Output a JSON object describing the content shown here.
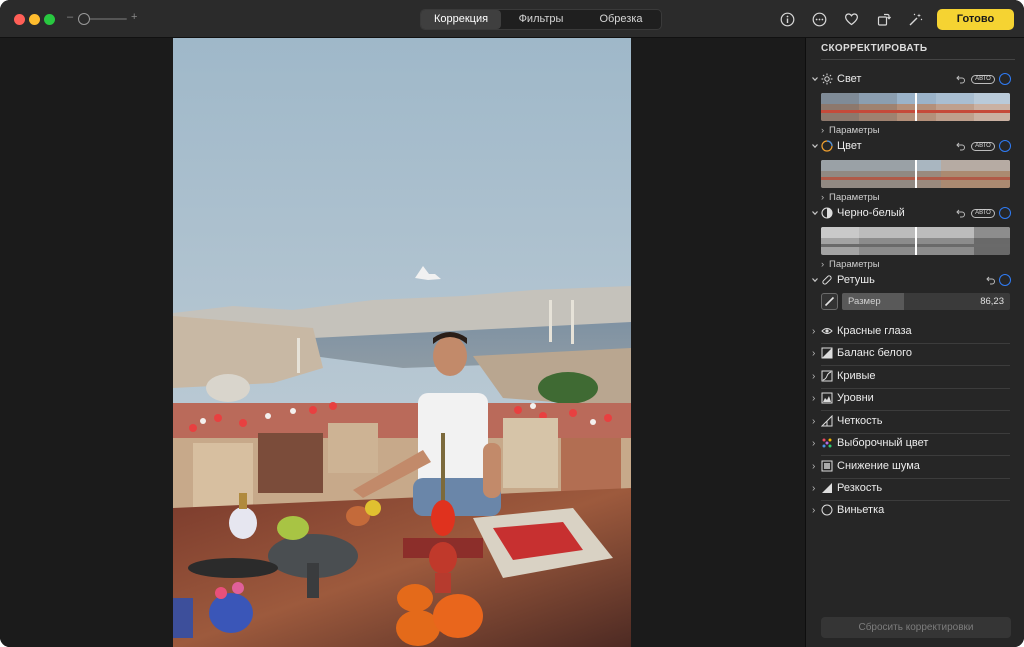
{
  "toolbar": {
    "zoom_minus": "–",
    "zoom_plus": "+",
    "tabs": [
      {
        "label": "Коррекция",
        "active": true
      },
      {
        "label": "Фильтры",
        "active": false
      },
      {
        "label": "Обрезка",
        "active": false
      }
    ],
    "icons": [
      "info-icon",
      "more-icon",
      "heart-icon",
      "rotate-icon",
      "magic-wand-icon"
    ],
    "done_label": "Готово"
  },
  "sidebar": {
    "title": "СКОРРЕКТИРОВАТЬ",
    "sections": [
      {
        "label": "Свет",
        "icon": "sun-icon",
        "auto": "АВТО",
        "params": "Параметры"
      },
      {
        "label": "Цвет",
        "icon": "color-circle-icon",
        "auto": "АВТО",
        "params": "Параметры"
      },
      {
        "label": "Черно-белый",
        "icon": "half-circle-icon",
        "auto": "АВТО",
        "params": "Параметры"
      },
      {
        "label": "Ретушь",
        "icon": "bandage-icon"
      }
    ],
    "retouch": {
      "size_label": "Размер",
      "size_value": "86,23",
      "size_fraction": 0.37
    },
    "tools": [
      {
        "label": "Красные глаза",
        "icon": "eye-icon"
      },
      {
        "label": "Баланс белого",
        "icon": "white-balance-icon"
      },
      {
        "label": "Кривые",
        "icon": "curves-icon"
      },
      {
        "label": "Уровни",
        "icon": "levels-icon"
      },
      {
        "label": "Четкость",
        "icon": "definition-icon"
      },
      {
        "label": "Выборочный цвет",
        "icon": "selective-color-icon"
      },
      {
        "label": "Снижение шума",
        "icon": "noise-icon"
      },
      {
        "label": "Резкость",
        "icon": "sharpen-icon"
      },
      {
        "label": "Виньетка",
        "icon": "vignette-icon"
      }
    ],
    "reset_label": "Сбросить корректировки"
  },
  "colors": {
    "accent": "#f5d332",
    "toggle": "#2f7cf6"
  }
}
